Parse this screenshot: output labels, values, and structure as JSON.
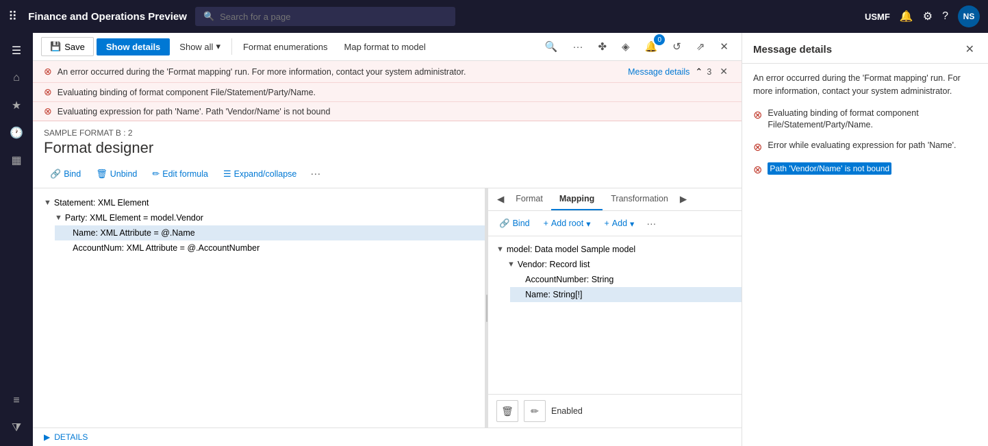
{
  "app": {
    "title": "Finance and Operations Preview",
    "env": "USMF",
    "user_initials": "NS",
    "search_placeholder": "Search for a page"
  },
  "toolbar": {
    "save_label": "Save",
    "show_details_label": "Show details",
    "show_all_label": "Show all",
    "format_enumerations_label": "Format enumerations",
    "map_format_label": "Map format to model",
    "badge_count": "0"
  },
  "errors": {
    "error1": "An error occurred during the 'Format mapping' run. For more information, contact your system administrator.",
    "error1_link": "Message details",
    "error_count": "3",
    "error2": "Evaluating binding of format component File/Statement/Party/Name.",
    "error3": "Evaluating expression for path 'Name'.  Path 'Vendor/Name' is not bound"
  },
  "designer": {
    "sample_label": "SAMPLE FORMAT B : 2",
    "title": "Format designer",
    "bind_label": "Bind",
    "unbind_label": "Unbind",
    "edit_formula_label": "Edit formula",
    "expand_collapse_label": "Expand/collapse"
  },
  "tree": {
    "items": [
      {
        "label": "Statement: XML Element",
        "indent": 0,
        "arrow": "▼",
        "selected": false
      },
      {
        "label": "Party: XML Element = model.Vendor",
        "indent": 1,
        "arrow": "▼",
        "selected": false
      },
      {
        "label": "Name: XML Attribute = @.Name",
        "indent": 2,
        "arrow": "",
        "selected": true
      },
      {
        "label": "AccountNum: XML Attribute = @.AccountNumber",
        "indent": 2,
        "arrow": "",
        "selected": false
      }
    ]
  },
  "mapping": {
    "tab_format": "Format",
    "tab_mapping": "Mapping",
    "tab_transformation": "Transformation",
    "active_tab": "Mapping",
    "bind_label": "Bind",
    "add_root_label": "Add root",
    "add_label": "Add",
    "enabled_label": "Enabled",
    "tree": [
      {
        "label": "model: Data model Sample model",
        "indent": 0,
        "arrow": "▼",
        "selected": false
      },
      {
        "label": "Vendor: Record list",
        "indent": 1,
        "arrow": "▼",
        "selected": false
      },
      {
        "label": "AccountNumber: String",
        "indent": 2,
        "arrow": "",
        "selected": false
      },
      {
        "label": "Name: String[!]",
        "indent": 2,
        "arrow": "",
        "selected": true
      }
    ]
  },
  "details_footer": {
    "label": "DETAILS"
  },
  "message_panel": {
    "title": "Message details",
    "description": "An error occurred during the 'Format mapping' run. For more information, contact your system administrator.",
    "error1_text": "Evaluating binding of format component File/Statement/Party/Name.",
    "error2_text": "Error while evaluating expression for path 'Name'.",
    "error3_highlight": "Path 'Vendor/Name' is not bound"
  },
  "sidebar": {
    "items": [
      "☰",
      "⌂",
      "★",
      "🕐",
      "▦",
      "☰"
    ]
  }
}
